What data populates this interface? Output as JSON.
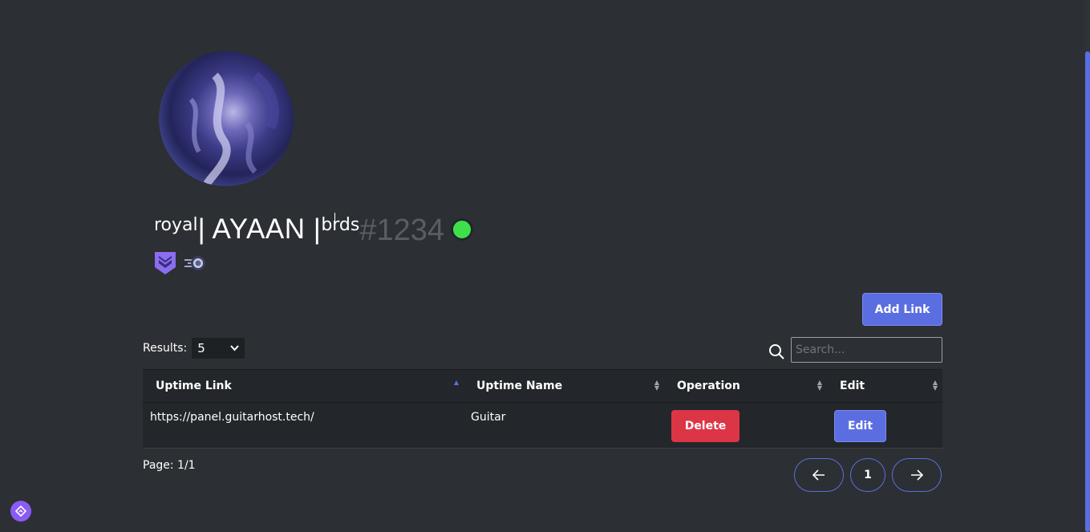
{
  "profile": {
    "name_prefix": "royal",
    "name_main": "| AYAAN |",
    "name_suffix": "brds",
    "discriminator": "#1234",
    "status_color": "#3ee04a",
    "badges": [
      "hypesquad-icon",
      "boost-icon"
    ]
  },
  "toolbar": {
    "add_link_label": "Add Link",
    "results_label": "Results:",
    "results_value": "5",
    "search_placeholder": "Search..."
  },
  "table": {
    "headers": [
      "Uptime Link",
      "Uptime Name",
      "Operation",
      "Edit"
    ],
    "rows": [
      {
        "link": "https://panel.guitarhost.tech/",
        "name": "Guitar",
        "operation_label": "Delete",
        "edit_label": "Edit"
      }
    ]
  },
  "pagination": {
    "page_info": "Page: 1/1",
    "current": "1",
    "prev_icon": "arrow-left-icon",
    "next_icon": "arrow-right-icon"
  },
  "colors": {
    "background": "#2c2f33",
    "accent": "#5b6ee1",
    "danger": "#dc3545"
  }
}
